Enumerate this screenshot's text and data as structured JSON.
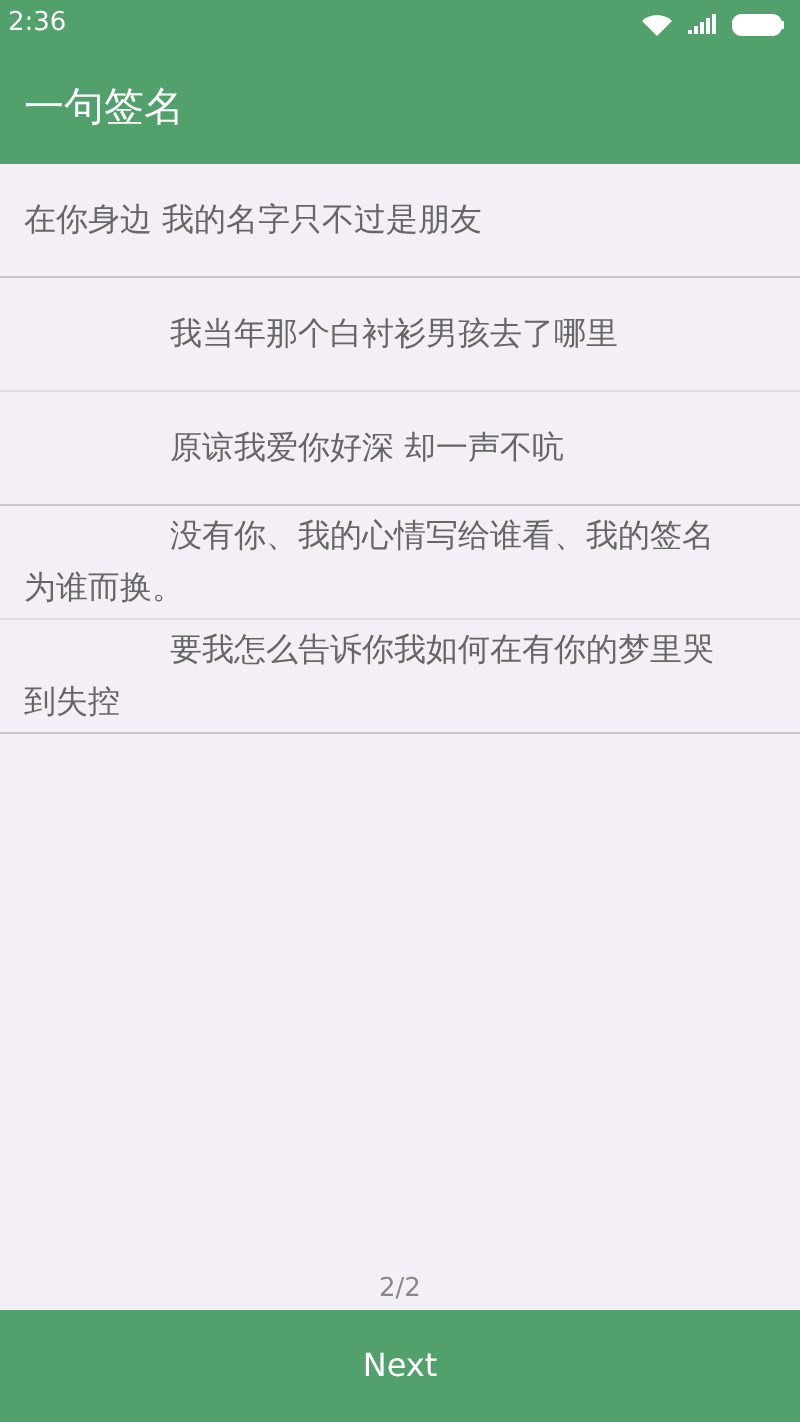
{
  "status_bar": {
    "time": "2:36"
  },
  "app_bar": {
    "title": "一句签名"
  },
  "items": [
    {
      "text": "在你身边 我的名字只不过是朋友",
      "indented": false
    },
    {
      "text": "我当年那个白衬衫男孩去了哪里",
      "indented": true
    },
    {
      "text": "原谅我爱你好深 却一声不吭",
      "indented": true
    },
    {
      "text": "没有你、我的心情写给谁看、我的签名为谁而换。",
      "indented": true
    },
    {
      "text": "要我怎么告诉你我如何在有你的梦里哭到失控",
      "indented": true
    }
  ],
  "page_indicator": "2/2",
  "next_button": "Next"
}
